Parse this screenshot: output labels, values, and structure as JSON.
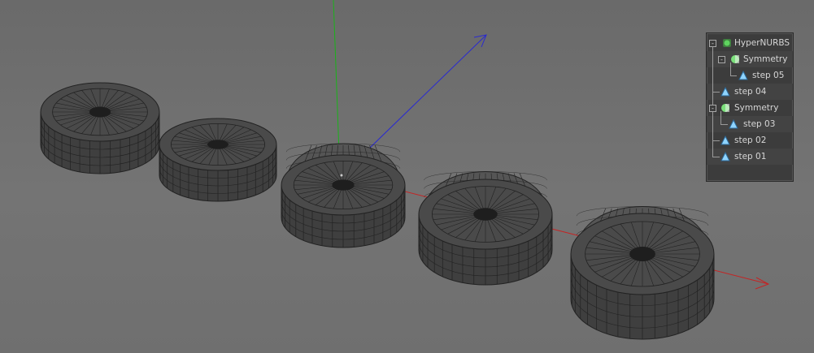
{
  "object_manager": {
    "items": [
      {
        "label": "HyperNURBS",
        "icon": "hypernurbs-icon",
        "depth": 0,
        "expander": true
      },
      {
        "label": "Symmetry",
        "icon": "symmetry-icon",
        "depth": 1,
        "expander": true
      },
      {
        "label": "step 05",
        "icon": "polygon-object-icon",
        "depth": 2,
        "expander": false
      },
      {
        "label": "step 04",
        "icon": "polygon-object-icon",
        "depth": 0,
        "expander": false
      },
      {
        "label": "Symmetry",
        "icon": "symmetry-icon",
        "depth": 0,
        "expander": true
      },
      {
        "label": "step 03",
        "icon": "polygon-object-icon",
        "depth": 1,
        "expander": false
      },
      {
        "label": "step 02",
        "icon": "polygon-object-icon",
        "depth": 0,
        "expander": false
      },
      {
        "label": "step 01",
        "icon": "polygon-object-icon",
        "depth": 0,
        "expander": false
      }
    ]
  },
  "colors": {
    "axis_x": "#c42424",
    "axis_y": "#19b319",
    "axis_z": "#2a2ad0",
    "mesh_fill": "#4a4a4a",
    "mesh_wire": "#222222",
    "symmetry_icon": "#7be07b",
    "hypernurbs_icon": "#5fd35f",
    "polygon_icon": "#8fd4ff"
  }
}
